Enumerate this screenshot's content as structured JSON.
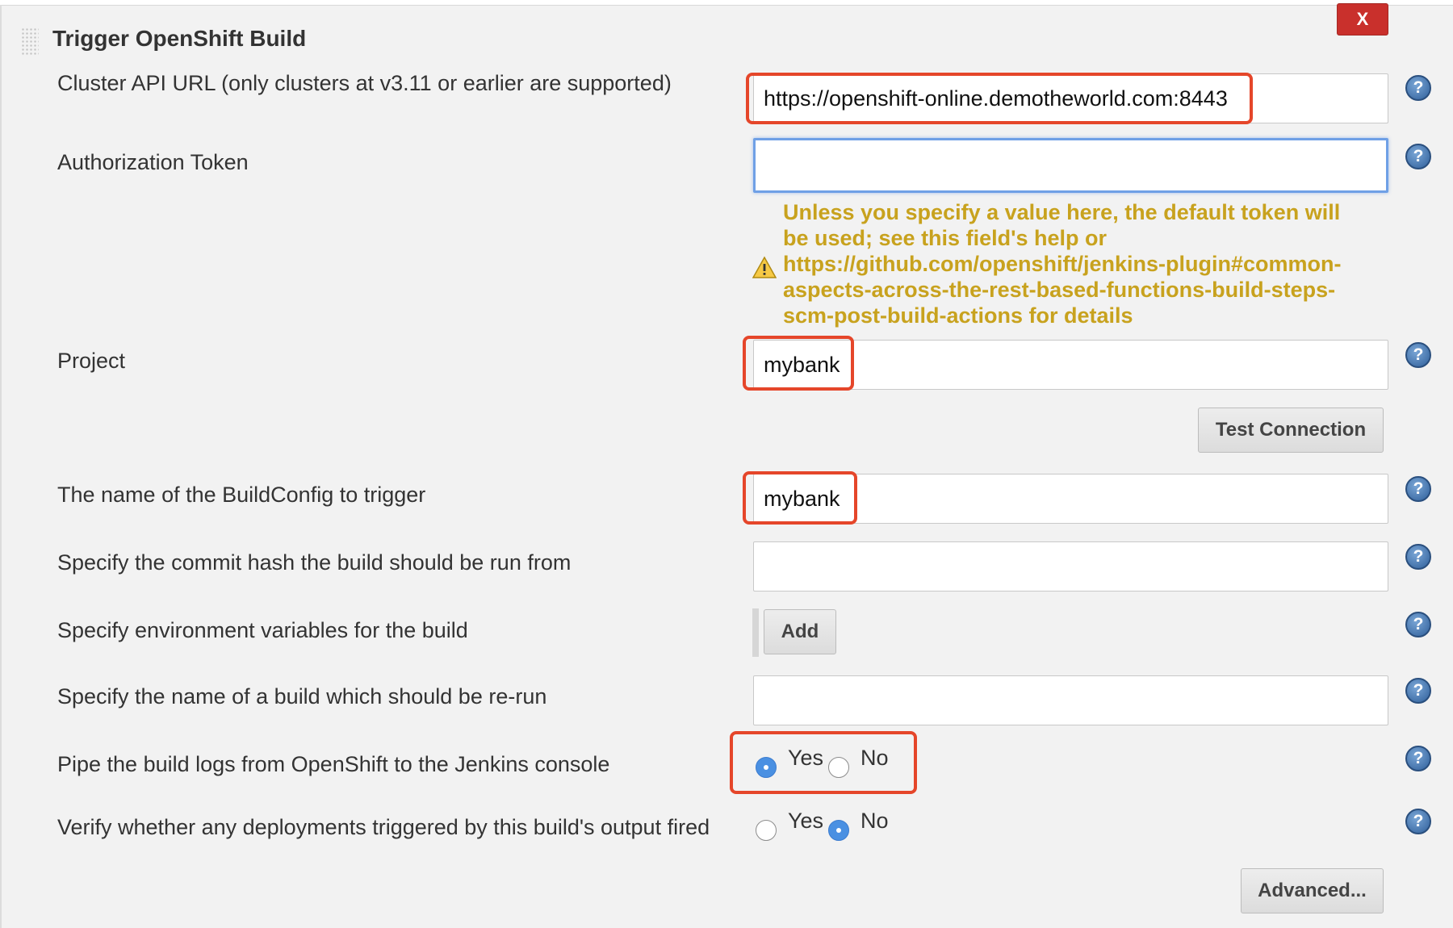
{
  "section": {
    "title": "Trigger OpenShift Build",
    "close_label": "X"
  },
  "fields": {
    "cluster_url": {
      "label": "Cluster API URL (only clusters at v3.11 or earlier are supported)",
      "value": "https://openshift-online.demotheworld.com:8443"
    },
    "auth_token": {
      "label": "Authorization Token",
      "value": "",
      "warning": "Unless you specify a value here, the default token will be used; see this field's help or https://github.com/openshift/jenkins-plugin#common-aspects-across-the-rest-based-functions-build-steps-scm-post-build-actions for details"
    },
    "project": {
      "label": "Project",
      "value": "mybank"
    },
    "test_connection_label": "Test Connection",
    "build_config": {
      "label": "The name of the BuildConfig to trigger",
      "value": "mybank"
    },
    "commit_hash": {
      "label": "Specify the commit hash the build should be run from",
      "value": ""
    },
    "env_vars": {
      "label": "Specify environment variables for the build",
      "add_label": "Add"
    },
    "rerun_build": {
      "label": "Specify the name of a build which should be re-run",
      "value": ""
    },
    "pipe_logs": {
      "label": "Pipe the build logs from OpenShift to the Jenkins console",
      "yes_label": "Yes",
      "no_label": "No",
      "selected": "Yes"
    },
    "verify_deployments": {
      "label": "Verify whether any deployments triggered by this build's output fired",
      "yes_label": "Yes",
      "no_label": "No",
      "selected": "No"
    },
    "advanced_label": "Advanced..."
  },
  "colors": {
    "highlight": "#e5462a",
    "warning": "#c8a21e",
    "close_button": "#c9302c",
    "radio_checked": "#4a90e2"
  },
  "icons": [
    "drag-handle-icon",
    "close-icon",
    "help-icon",
    "warning-icon"
  ]
}
